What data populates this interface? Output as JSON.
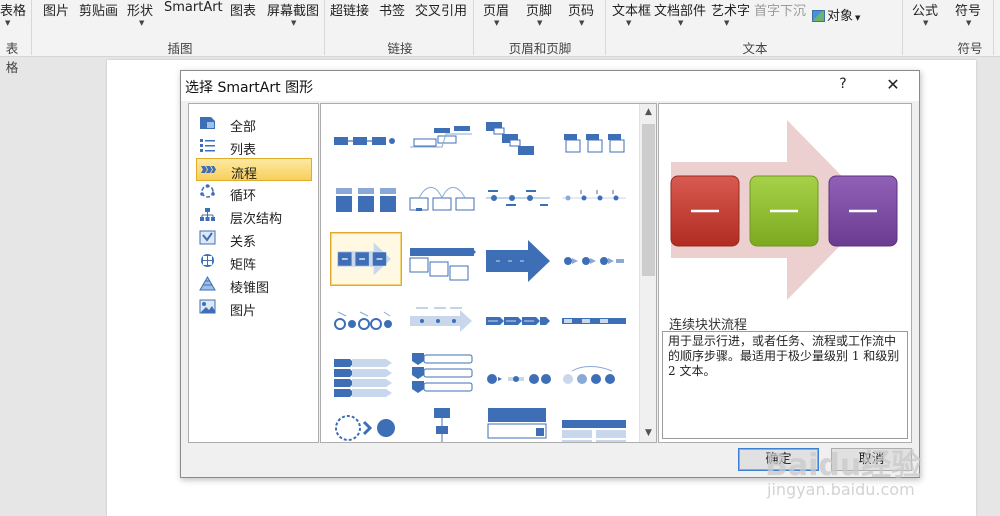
{
  "ribbon": {
    "items": [
      "表格",
      "图片",
      "剪贴画",
      "形状",
      "SmartArt",
      "图表",
      "屏幕截图",
      "超链接",
      "书签",
      "交叉引用",
      "页眉",
      "页脚",
      "页码",
      "文本框",
      "文档部件",
      "艺术字",
      "首字下沉",
      "对象",
      "公式",
      "符号"
    ],
    "groups": [
      "表格",
      "插图",
      "链接",
      "页眉和页脚",
      "文本",
      "符号"
    ]
  },
  "dialog": {
    "title": "选择 SmartArt 图形",
    "help": "?",
    "close": "✕",
    "categories": [
      {
        "label": "全部",
        "icon": "all-icon",
        "selected": false
      },
      {
        "label": "列表",
        "icon": "list-icon",
        "selected": false
      },
      {
        "label": "流程",
        "icon": "process-icon",
        "selected": true
      },
      {
        "label": "循环",
        "icon": "cycle-icon",
        "selected": false
      },
      {
        "label": "层次结构",
        "icon": "hierarchy-icon",
        "selected": false
      },
      {
        "label": "关系",
        "icon": "relationship-icon",
        "selected": false
      },
      {
        "label": "矩阵",
        "icon": "matrix-icon",
        "selected": false
      },
      {
        "label": "棱锥图",
        "icon": "pyramid-icon",
        "selected": false
      },
      {
        "label": "图片",
        "icon": "picture-icon",
        "selected": false
      }
    ],
    "preview": {
      "name": "连续块状流程",
      "description": "用于显示行进，或者任务、流程或工作流中的顺序步骤。最适用于极少量级别 1 和级别 2 文本。"
    },
    "buttons": {
      "ok": "确定",
      "cancel": "取消"
    }
  },
  "colors": {
    "accent_blue": "#3e6fb6",
    "selected_gold": "#f8cf5c",
    "red_block": "#c0392f",
    "green_block": "#8cbc2e",
    "purple_block": "#7a4a9e",
    "arrow_pink": "#eccfcf"
  },
  "watermark": {
    "logo": "Baidu经验",
    "url": "jingyan.baidu.com"
  }
}
